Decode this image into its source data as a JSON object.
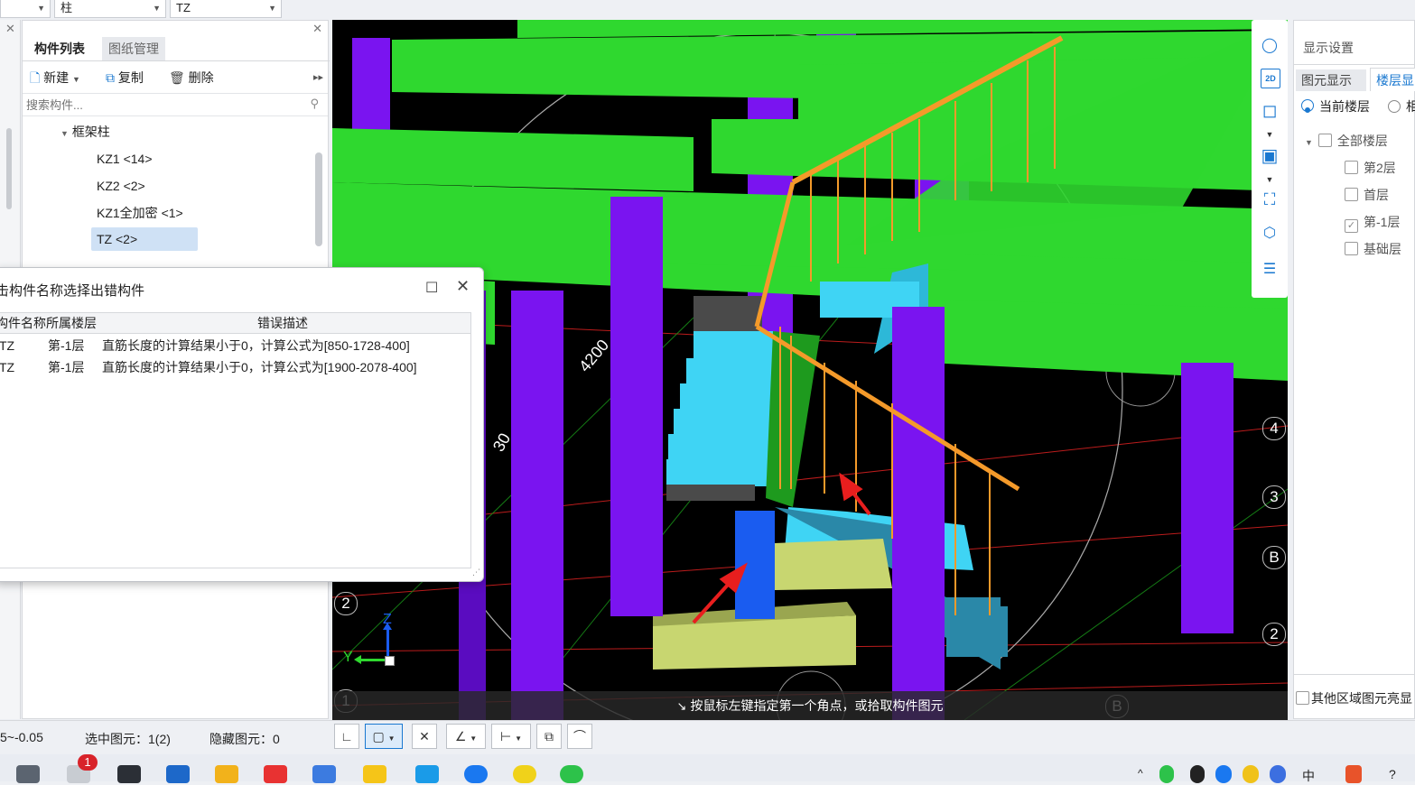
{
  "topbar": {
    "dropdown1": "",
    "dropdown2": "柱",
    "dropdown3": "TZ"
  },
  "component_panel": {
    "tabs": [
      "构件列表",
      "图纸管理"
    ],
    "toolbar": {
      "new": "新建",
      "copy": "复制",
      "delete": "删除"
    },
    "search_placeholder": "搜索构件...",
    "tree": {
      "group": "框架柱",
      "items": [
        "KZ1 <14>",
        "KZ2 <2>",
        "KZ1全加密 <1>",
        "TZ <2>"
      ],
      "selected_index": 3
    }
  },
  "error_dialog": {
    "title": "击构件名称选择出错构件",
    "columns": [
      "构件名称",
      "所属楼层",
      "错误描述"
    ],
    "rows": [
      {
        "name": "TZ",
        "floor": "第-1层",
        "desc": "直筋长度的计算结果小于0，计算公式为[850-1728-400]"
      },
      {
        "name": "TZ",
        "floor": "第-1层",
        "desc": "直筋长度的计算结果小于0，计算公式为[1900-2078-400]"
      }
    ]
  },
  "viewport": {
    "dimension_labels": [
      "4200",
      "30"
    ],
    "axis_labels": {
      "z": "Z",
      "y": "Y"
    },
    "grid_numbers_right": [
      "4",
      "3",
      "B",
      "2"
    ],
    "grid_numbers_left": [
      "2",
      "1"
    ],
    "grid_bottom": "B",
    "status_message": "按鼠标左键指定第一个角点，或拾取构件图元",
    "toolbar_2d": "2D"
  },
  "display_settings": {
    "title": "显示设置",
    "tabs": [
      "图元显示",
      "楼层显"
    ],
    "radios": [
      "当前楼层",
      "相"
    ],
    "tree": [
      {
        "label": "全部楼层",
        "checked": false
      },
      {
        "label": "第2层",
        "checked": false
      },
      {
        "label": "首层",
        "checked": false
      },
      {
        "label": "第-1层",
        "checked": true
      },
      {
        "label": "基础层",
        "checked": false
      }
    ],
    "other": "其他区域图元亮显"
  },
  "statusbar": {
    "elevation": "5~-0.05",
    "selected": "选中图元：1(2)",
    "hidden": "隐藏图元：0"
  },
  "taskbar": {
    "badge": "1",
    "tray_text": "中"
  },
  "colors": {
    "beam": "#2fd82f",
    "column": "#7a14f0",
    "stair": "#3fd4f4",
    "rail": "#f49a2a",
    "found": "#c8d670",
    "selected_column": "#1a5cf0",
    "arrow": "#e81e1e"
  }
}
